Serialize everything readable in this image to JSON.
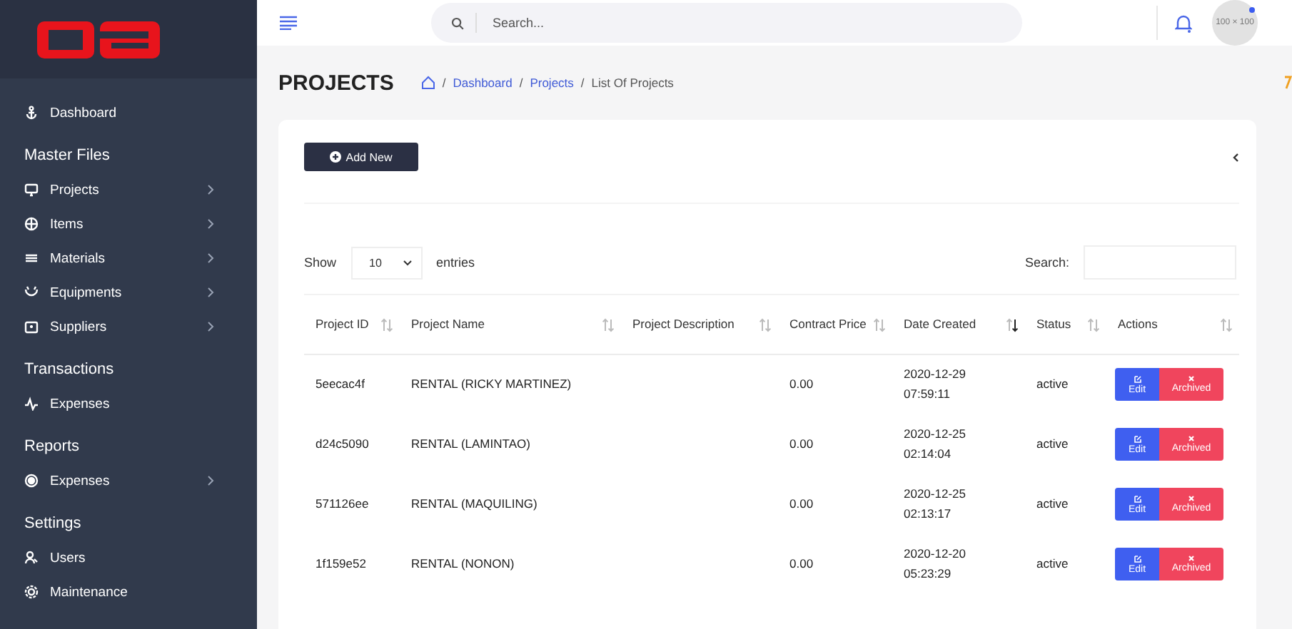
{
  "sidebar": {
    "sections": [
      {
        "items": [
          {
            "label": "Dashboard",
            "has_arrow": false
          }
        ]
      },
      {
        "heading": "Master Files",
        "items": [
          {
            "label": "Projects",
            "has_arrow": true
          },
          {
            "label": "Items",
            "has_arrow": true
          },
          {
            "label": "Materials",
            "has_arrow": true
          },
          {
            "label": "Equipments",
            "has_arrow": true
          },
          {
            "label": "Suppliers",
            "has_arrow": true
          }
        ]
      },
      {
        "heading": "Transactions",
        "items": [
          {
            "label": "Expenses",
            "has_arrow": false
          }
        ]
      },
      {
        "heading": "Reports",
        "items": [
          {
            "label": "Expenses",
            "has_arrow": true
          }
        ]
      },
      {
        "heading": "Settings",
        "items": [
          {
            "label": "Users",
            "has_arrow": false
          },
          {
            "label": "Maintenance",
            "has_arrow": false
          }
        ]
      }
    ]
  },
  "topbar": {
    "search_placeholder": "Search...",
    "avatar_text": "100 × 100",
    "avatar_online": true
  },
  "page": {
    "title": "PROJECTS",
    "breadcrumb": [
      {
        "separator": "/",
        "label": "Dashboard",
        "link": true
      },
      {
        "separator": "/",
        "label": "Projects",
        "link": true
      },
      {
        "separator": "/",
        "label": "List Of Projects",
        "link": false
      }
    ]
  },
  "card": {
    "add_button": "Add New",
    "show_label": "Show",
    "entries_value": "10",
    "entries_label": "entries",
    "search_label": "Search:"
  },
  "table": {
    "columns": [
      {
        "label": "Project ID",
        "sorted": false
      },
      {
        "label": "Project Name",
        "sorted": false
      },
      {
        "label": "Project Description",
        "sorted": false
      },
      {
        "label": "Contract Price",
        "sorted": false
      },
      {
        "label": "Date Created",
        "sorted": true
      },
      {
        "label": "Status",
        "sorted": false
      },
      {
        "label": "Actions",
        "sorted": false
      }
    ],
    "rows": [
      {
        "id": "5eecac4f",
        "name": "RENTAL (RICKY MARTINEZ)",
        "price": "0.00",
        "date": "2020-12-29",
        "time": "07:59:11",
        "status": "active",
        "edit": "Edit",
        "archive": "Archived"
      },
      {
        "id": "d24c5090",
        "name": "RENTAL (LAMINTAO)",
        "price": "0.00",
        "date": "2020-12-25",
        "time": "02:14:04",
        "status": "active",
        "edit": "Edit",
        "archive": "Archived"
      },
      {
        "id": "571126ee",
        "name": "RENTAL (MAQUILING)",
        "price": "0.00",
        "date": "2020-12-25",
        "time": "02:13:17",
        "status": "active",
        "edit": "Edit",
        "archive": "Archived"
      },
      {
        "id": "1f159e52",
        "name": "RENTAL (NONON)",
        "price": "0.00",
        "date": "2020-12-20",
        "time": "05:23:29",
        "status": "active",
        "edit": "Edit",
        "archive": "Archived"
      }
    ]
  }
}
